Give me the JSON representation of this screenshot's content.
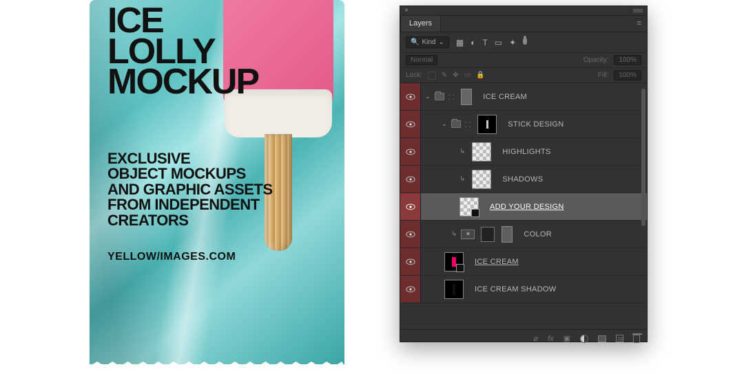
{
  "mockup": {
    "title_l1": "ICE",
    "title_l2": "LOLLY",
    "title_l3": "MOCKUP",
    "sub_l1": "EXCLUSIVE",
    "sub_l2": "OBJECT MOCKUPS",
    "sub_l3": "AND GRAPHIC ASSETS",
    "sub_l4": "FROM INDEPENDENT",
    "sub_l5": "CREATORS",
    "url": "YELLOW/IMAGES.COM"
  },
  "panel": {
    "tab": "Layers",
    "search_label": "Kind",
    "blend_mode": "Normal",
    "opacity_label": "Opacity:",
    "opacity_value": "100%",
    "lock_label": "Lock:",
    "fill_label": "Fill:",
    "fill_value": "100%",
    "layers": [
      {
        "name": "ICE CREAM",
        "type": "group-open",
        "indent": 0
      },
      {
        "name": "STICK DESIGN",
        "type": "group-open",
        "indent": 1,
        "thumb": "black"
      },
      {
        "name": "HIGHLIGHTS",
        "type": "clipped",
        "indent": 2,
        "thumb": "checker"
      },
      {
        "name": "SHADOWS",
        "type": "clipped",
        "indent": 2,
        "thumb": "checker"
      },
      {
        "name": "ADD YOUR DESIGN",
        "type": "smart",
        "indent": 2,
        "thumb": "checker",
        "selected": true,
        "underline": true
      },
      {
        "name": "COLOR",
        "type": "adjustment",
        "indent": 2,
        "thumb": "gray"
      },
      {
        "name": "ICE CREAM",
        "type": "smart",
        "indent": 1,
        "thumb": "pink",
        "underline": true
      },
      {
        "name": "ICE CREAM SHADOW",
        "type": "layer",
        "indent": 1,
        "thumb": "black-shadow"
      }
    ],
    "footer_fx": "fx"
  }
}
